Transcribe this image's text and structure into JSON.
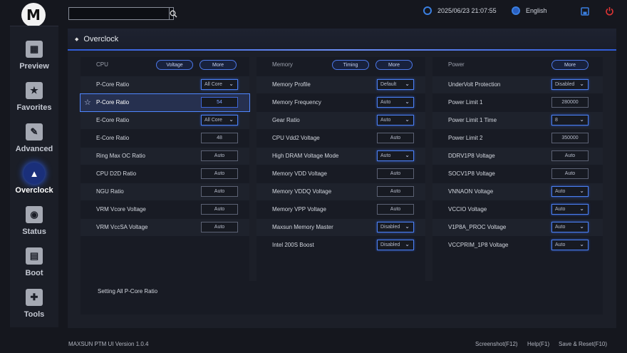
{
  "header": {
    "logo": "M",
    "datetime": "2025/06/23 21:07:55",
    "language": "English"
  },
  "sidebar": [
    {
      "label": "Preview",
      "icon": "grid-icon"
    },
    {
      "label": "Favorites",
      "icon": "star-icon"
    },
    {
      "label": "Advanced",
      "icon": "wrench-icon"
    },
    {
      "label": "Overclock",
      "icon": "rocket-icon"
    },
    {
      "label": "Status",
      "icon": "gauge-icon"
    },
    {
      "label": "Boot",
      "icon": "ssd-icon"
    },
    {
      "label": "Tools",
      "icon": "tools-icon"
    }
  ],
  "page": {
    "title": "Overclock"
  },
  "cpu": {
    "title": "CPU",
    "btn1": "Voltage",
    "btn2": "More",
    "rows": [
      {
        "label": "P-Core Ratio",
        "value": "All Core",
        "type": "drop"
      },
      {
        "label": "P-Core Ratio",
        "value": "54",
        "type": "field"
      },
      {
        "label": "E-Core Ratio",
        "value": "All Core",
        "type": "drop"
      },
      {
        "label": "E-Core Ratio",
        "value": "48",
        "type": "field"
      },
      {
        "label": "Ring Max OC Ratio",
        "value": "Auto",
        "type": "field"
      },
      {
        "label": "CPU D2D Ratio",
        "value": "Auto",
        "type": "field"
      },
      {
        "label": "NGU Ratio",
        "value": "Auto",
        "type": "field"
      },
      {
        "label": "VRM Vcore Voltage",
        "value": "Auto",
        "type": "field"
      },
      {
        "label": "VRM VccSA Voltage",
        "value": "Auto",
        "type": "field"
      }
    ]
  },
  "memory": {
    "title": "Memory",
    "btn1": "Timing",
    "btn2": "More",
    "rows": [
      {
        "label": "Memory Profile",
        "value": "Default",
        "type": "drop"
      },
      {
        "label": "Memory Frequency",
        "value": "Auto",
        "type": "drop"
      },
      {
        "label": "Gear Ratio",
        "value": "Auto",
        "type": "drop"
      },
      {
        "label": "CPU Vdd2 Voltage",
        "value": "Auto",
        "type": "field"
      },
      {
        "label": "High DRAM Voltage Mode",
        "value": "Auto",
        "type": "drop"
      },
      {
        "label": "Memory VDD Voltage",
        "value": "Auto",
        "type": "field"
      },
      {
        "label": "Memory VDDQ Voltage",
        "value": "Auto",
        "type": "field"
      },
      {
        "label": "Memory VPP Voltage",
        "value": "Auto",
        "type": "field"
      },
      {
        "label": "Maxsun Memory Master",
        "value": "Disabled",
        "type": "drop"
      },
      {
        "label": "Intel 200S Boost",
        "value": "Disabled",
        "type": "drop"
      }
    ]
  },
  "power": {
    "title": "Power",
    "btn2": "More",
    "rows": [
      {
        "label": "UnderVolt Protection",
        "value": "Disabled",
        "type": "drop"
      },
      {
        "label": "Power Limit 1",
        "value": "280000",
        "type": "field"
      },
      {
        "label": "Power Limit 1 Time",
        "value": "8",
        "type": "drop"
      },
      {
        "label": "Power Limit 2",
        "value": "350000",
        "type": "field"
      },
      {
        "label": "DDRV1P8 Voltage",
        "value": "Auto",
        "type": "field"
      },
      {
        "label": "SOCV1P8 Voltage",
        "value": "Auto",
        "type": "field"
      },
      {
        "label": "VNNAON Voltage",
        "value": "Auto",
        "type": "drop"
      },
      {
        "label": "VCCIO Voltage",
        "value": "Auto",
        "type": "drop"
      },
      {
        "label": "V1P8A_PROC Voltage",
        "value": "Auto",
        "type": "drop"
      },
      {
        "label": "VCCPRIM_1P8 Voltage",
        "value": "Auto",
        "type": "drop"
      }
    ]
  },
  "help": {
    "text": "Setting All P-Core Ratio"
  },
  "footer": {
    "version": "MAXSUN PTM UI Version 1.0.4",
    "screenshot": "Screenshot(F12)",
    "help": "Help(F1)",
    "save": "Save & Reset(F10)"
  },
  "colors": {
    "accent": "#3a7fe0",
    "power": "#e03535"
  }
}
